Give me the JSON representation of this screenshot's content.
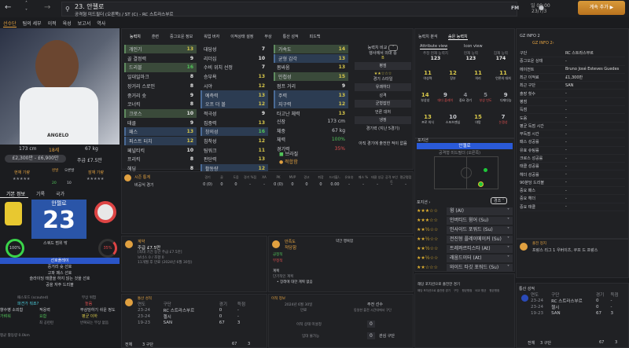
{
  "header": {
    "title": "23. 안젤로",
    "subtitle": "공격형 미드필더 (오른쪽) / ST (C) - RC 스트라스부르",
    "fm": "FM",
    "time": "일 09:00",
    "date": "23/7/3",
    "continue": "계속 추가 ▶"
  },
  "nav": [
    "선수단",
    "팀의 세부",
    "이적",
    "육성",
    "보고서",
    "역사"
  ],
  "player": {
    "height": "173 cm",
    "age": "18세",
    "weight": "67 kg",
    "value": "£2,300만 - £6,900만",
    "wage": "주급 £7.5만",
    "current_ability_label": "현재 기량",
    "potential_label": "잠재 기량",
    "left_foot_label": "왼발",
    "right_foot_label": "오른발",
    "left_foot": "20",
    "right_foot": "10",
    "name": "안젤로",
    "number": "23",
    "squad_status": "스쿼드 범위 밖",
    "fitness": "100%",
    "fitness_value": 100,
    "condition": "35%",
    "condition_value": 35,
    "shirt_name": "ANGELO"
  },
  "left_tabs": [
    "기본 정보",
    "기록",
    "국가"
  ],
  "preferred": {
    "title": "선호플레이",
    "items": [
      "중거리 슛 선호",
      "고파 패스 선호",
      "슬라이딩 태클을 하지 않는 것을 선호",
      "공을 자주 드리블"
    ]
  },
  "misc": {
    "scout_label": "패스포드 (scouted)",
    "scout_value": "파견가 뭐죠?",
    "injury_label": "부상 위험",
    "injury_value": "높음",
    "homesick_label": "향수병 소외함",
    "homesick_value": "가벼워",
    "adapt_label": "적응력",
    "adapt_value": "요함",
    "injury_prone_label": "부상당하기 쉬운 정도",
    "injury_prone_value": "평균 이하",
    "note1": "최 공련련",
    "note2": "반복되는 부상 없음",
    "distance": "평균 활동량 0.0km"
  },
  "attr_tabs": [
    "능력치",
    "훈련",
    "중그오운 정보",
    "워업 버자",
    "이적상태 설정",
    "부상",
    "통산 성적",
    "피드백"
  ],
  "technical": [
    [
      "개인기",
      "13",
      "g",
      "y"
    ],
    [
      "골 결정력",
      "9",
      "",
      ""
    ],
    [
      "드리블",
      "16",
      "g",
      "gr"
    ],
    [
      "일대일마크",
      "8",
      "",
      ""
    ],
    [
      "장거리 스로인",
      "8",
      "",
      ""
    ],
    [
      "중거리 슛",
      "9",
      "",
      ""
    ],
    [
      "코너킥",
      "8",
      "",
      ""
    ],
    [
      "크로스",
      "10",
      "g",
      ""
    ],
    [
      "태클",
      "9",
      "",
      ""
    ],
    [
      "패스",
      "13",
      "b",
      "y"
    ],
    [
      "퍼스트 터치",
      "12",
      "b",
      "y"
    ],
    [
      "페널티킥",
      "10",
      "",
      ""
    ],
    [
      "프리킥",
      "8",
      "",
      ""
    ],
    [
      "헤딩",
      "8",
      "",
      ""
    ]
  ],
  "mental": [
    [
      "대담성",
      "7",
      "",
      ""
    ],
    [
      "리더십",
      "10",
      "",
      ""
    ],
    [
      "수비 위치 선정",
      "7",
      "",
      ""
    ],
    [
      "승부욕",
      "13",
      "",
      "y"
    ],
    [
      "시야",
      "12",
      "",
      "y"
    ],
    [
      "예측력",
      "13",
      "b",
      "y"
    ],
    [
      "오프 더 볼",
      "12",
      "b",
      "y"
    ],
    [
      "적극성",
      "9",
      "",
      ""
    ],
    [
      "집중력",
      "13",
      "",
      "y"
    ],
    [
      "창의성",
      "16",
      "b",
      "gr"
    ],
    [
      "침착성",
      "12",
      "",
      "y"
    ],
    [
      "팀워크",
      "11",
      "",
      "y"
    ],
    [
      "판단력",
      "13",
      "",
      "y"
    ],
    [
      "활동량",
      "12",
      "b",
      "y"
    ]
  ],
  "physical": [
    [
      "가속도",
      "14",
      "g",
      "y"
    ],
    [
      "균형 감각",
      "13",
      "b",
      "y"
    ],
    [
      "몸싸움",
      "13",
      "",
      "y"
    ],
    [
      "민첩성",
      "15",
      "g",
      "y"
    ],
    [
      "점프 거리",
      "9",
      "",
      ""
    ],
    [
      "주력",
      "13",
      "b",
      "y"
    ],
    [
      "지구력",
      "12",
      "b",
      "y"
    ],
    [
      "타고난 체력",
      "13",
      "",
      "y"
    ]
  ],
  "body": [
    [
      "신장",
      "173 cm",
      ""
    ],
    [
      "체중",
      "67 kg",
      ""
    ],
    [
      "체력",
      "100%",
      "green"
    ],
    [
      "경기력",
      "35%",
      "red"
    ]
  ],
  "nation": "브라질",
  "role_tag": "적합함",
  "compare": {
    "label": "능력치 비교",
    "sub": "행사에서 의대 중",
    "grade": "B",
    "items": [
      "평점",
      "경기 스타일",
      "유쾌하다",
      "성격",
      "균형잡힌",
      "언론 대처",
      "냉정",
      "경기력 (지난 5경기)"
    ],
    "empty": "아직 경기에 출전한 적이 없음"
  },
  "season": {
    "title": "시즌 통계",
    "headers": [
      "경기",
      "골",
      "도움",
      "경기 %점",
      "XA",
      "PK",
      "MVP",
      "경고",
      "퇴장",
      "드리블/..",
      "유효슛",
      "패스 %",
      "태클 성공",
      "공격 포인트",
      "평균평점"
    ],
    "row_label": "비공식 경기",
    "values": [
      "0 (0)",
      "0",
      "0",
      "-",
      "-",
      "0 (0)",
      "0",
      "0",
      "0",
      "0.00",
      "-",
      "-",
      "-",
      "-",
      "-"
    ]
  },
  "contract": {
    "title": "계약",
    "wage": "주급 £7.5만",
    "lines": [
      "[최대 기간 동안 주급 £7.5만]",
      "보너스 0 / 조항 0",
      "11개월 후 만료 (2024년 6월 30일)"
    ]
  },
  "happiness": {
    "title": "만족도",
    "right": "약간 행복함",
    "status": "적당함",
    "positive": "긍정적",
    "negative": "부정적",
    "plans_label": "계획",
    "plans_sub": "단기적인 계획",
    "plan_item": "장래에 대한 계획 없음"
  },
  "career": {
    "title": "통산 성적",
    "headers": [
      "연도",
      "구단",
      "경기",
      "득점"
    ],
    "rows": [
      [
        "23-24",
        "RC 스트라스부르",
        "0",
        "-"
      ],
      [
        "23-24",
        "첼시",
        "0",
        "-"
      ],
      [
        "19-23",
        "SAN",
        "67",
        "3"
      ]
    ],
    "total_label": "전체",
    "total_clubs": "3 구단",
    "total_apps": "67",
    "total_goals": "3"
  },
  "transfer": {
    "title": "이적 정보",
    "date": "2024년 6월 30일",
    "date_sub": "만료",
    "status_title": "주전 선수",
    "status_sub": "동일한 출전 시간대에서 구단",
    "row1": "이적 상태 미설정",
    "row2": "임대 불가능",
    "count1": "0",
    "count2": "0",
    "interest": "관심 구단"
  },
  "analysis": {
    "tabs": [
      "능력치 분석",
      "숨은 능력치"
    ],
    "views": [
      "Attribute view",
      "Icon view"
    ],
    "ability": [
      [
        "추정 현재 능력치",
        "123"
      ],
      [
        "현재 능력",
        "123"
      ],
      [
        "잠재 능력",
        "174"
      ]
    ],
    "grid": [
      [
        "11",
        "야성력",
        "yellow",
        ""
      ],
      [
        "12",
        "장부",
        "yellow",
        ""
      ],
      [
        "11",
        "의리",
        "yellow",
        ""
      ],
      [
        "11",
        "언론의 대처",
        "yellow",
        ""
      ],
      [
        "14",
        "부상성",
        "yellow",
        ""
      ],
      [
        "9",
        "대다 플레이",
        "",
        "red"
      ],
      [
        "4",
        "중요 경기",
        "muted",
        ""
      ],
      [
        "5",
        "부상 빈도",
        "muted",
        "red"
      ],
      [
        "9",
        "다재다능",
        "",
        ""
      ],
      [
        "13",
        "프로 의식",
        "yellow",
        ""
      ],
      [
        "10",
        "스포츠맨십",
        "",
        ""
      ],
      [
        "15",
        "야망",
        "yellow",
        ""
      ],
      [
        "7",
        "논쟁성",
        "",
        "red"
      ]
    ]
  },
  "position": {
    "label": "포지션",
    "name": "안젤로",
    "role": "공격형 미드필더 (오른쪽)",
    "list_label": "포지션 ›",
    "filter": "경조",
    "roles": [
      [
        "윙 (AI)",
        3
      ],
      [
        "인버티드 윙어 (Su)",
        3
      ],
      [
        "인사이드 포워드 (Su)",
        2.5
      ],
      [
        "전진형 플레이메이커 (Su)",
        2.5
      ],
      [
        "트레콰르티스타 (At)",
        2.5
      ],
      [
        "래움드이터 (At)",
        2.5
      ],
      [
        "와이드 타깃 포워드 (Su)",
        2
      ]
    ]
  },
  "matches": {
    "title": "해당 포지션으로 출전한 경기",
    "headers": [
      "해당 포지션으로 출전한 경기",
      "구단",
      "평균평점",
      "비교 평균",
      "평균평점"
    ]
  },
  "gz": {
    "title": "GZ INFO 2",
    "link": "GZ INFO 2›",
    "rows": [
      [
        "구단",
        "RC 스트라스부르"
      ],
      [
        "중그오운 상태",
        "-"
      ],
      [
        "에이전트",
        "Bruno José Esteves Guedes"
      ],
      [
        "최근 이적료",
        "£1,300만"
      ],
      [
        "최근 구단",
        "SAN"
      ],
      [
        "출장 횟수",
        "-"
      ],
      [
        "평점",
        "-"
      ],
      [
        "득점",
        "-"
      ],
      [
        "도움",
        "-"
      ],
      [
        "평균 득점 시간",
        "-"
      ],
      [
        "무득점 시간",
        "-"
      ],
      [
        "패스 성공률",
        "-"
      ],
      [
        "유효 슈팅률",
        "-"
      ],
      [
        "크로스 성공률",
        "-"
      ],
      [
        "태클 성공률",
        "-"
      ],
      [
        "헤더 성공률",
        "-"
      ],
      [
        "90분당 드리블",
        "-"
      ],
      [
        "중요 패스",
        "-"
      ],
      [
        "중요 헤더",
        "-"
      ],
      [
        "중요 태클",
        "-"
      ]
    ]
  },
  "award": {
    "title": "출전 정지",
    "text": "프랑스 리그 1 우버이츠, 쿠프 드 프랑스"
  },
  "colors": {
    "accent": "#e0a040",
    "blue": "#2a5ab8",
    "green": "#52c45a"
  }
}
